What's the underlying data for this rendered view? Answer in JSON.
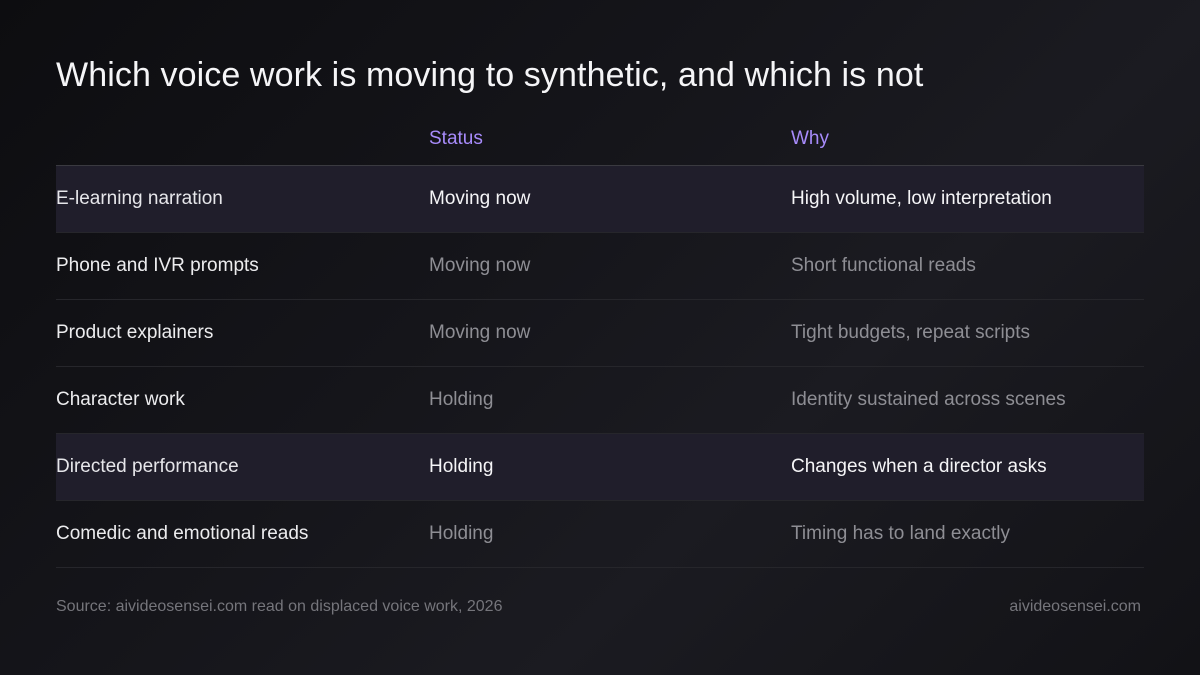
{
  "title": "Which voice work is moving to synthetic, and which is not",
  "table": {
    "headers": {
      "task": "",
      "status": "Status",
      "why": "Why"
    },
    "rows": [
      {
        "task": "E-learning narration",
        "status": "Moving now",
        "why": "High volume, low interpretation",
        "highlighted": true
      },
      {
        "task": "Phone and IVR prompts",
        "status": "Moving now",
        "why": "Short functional reads",
        "highlighted": false
      },
      {
        "task": "Product explainers",
        "status": "Moving now",
        "why": "Tight budgets, repeat scripts",
        "highlighted": false
      },
      {
        "task": "Character work",
        "status": "Holding",
        "why": "Identity sustained across scenes",
        "highlighted": false
      },
      {
        "task": "Directed performance",
        "status": "Holding",
        "why": "Changes when a director asks",
        "highlighted": true
      },
      {
        "task": "Comedic and emotional reads",
        "status": "Holding",
        "why": "Timing has to land exactly",
        "highlighted": false
      }
    ]
  },
  "footer": {
    "source": "Source: aivideosensei.com read on displaced voice work, 2026",
    "brand": "aivideosensei.com"
  },
  "colors": {
    "accent": "#a78bfa",
    "highlight_row": "#201e2b"
  }
}
